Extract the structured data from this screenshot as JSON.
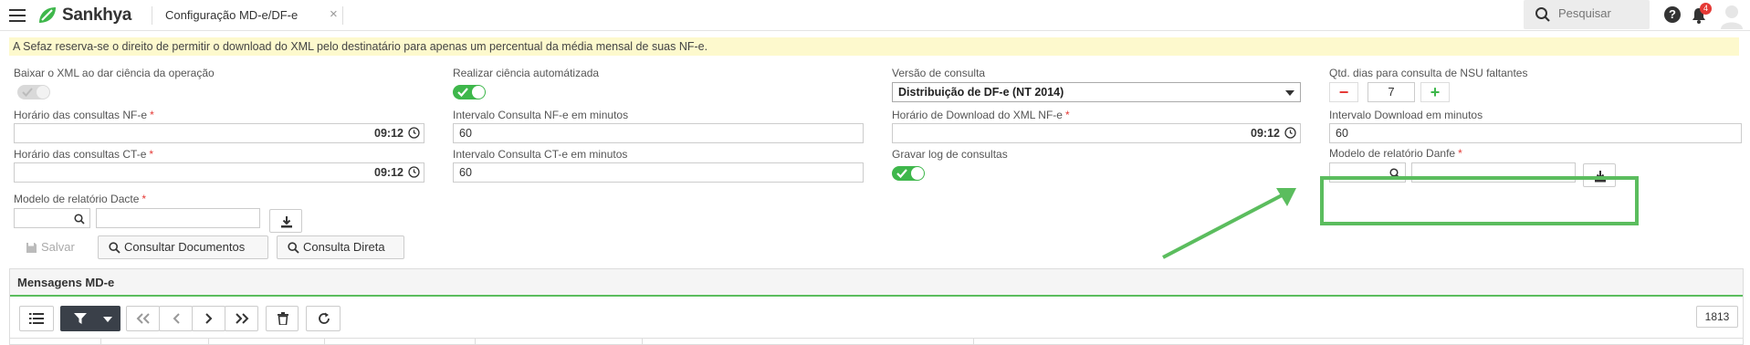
{
  "app": {
    "brand": "Sankhya",
    "tab_title": "Configuração MD-e/DF-e",
    "tab_close": "×"
  },
  "header": {
    "search_placeholder": "Pesquisar",
    "help": "?",
    "notification_count": "4"
  },
  "notice": "A Sefaz reserva-se o direito de permitir o download do XML pelo destinatário para apenas um percentual da média mensal de suas NF-e.",
  "form": {
    "baixar_xml": {
      "label": "Baixar o XML ao dar ciência da operação",
      "enabled": false
    },
    "realizar_ciencia": {
      "label": "Realizar ciência automátizada",
      "enabled": true
    },
    "versao_consulta": {
      "label": "Versão de consulta",
      "value": "Distribuição de DF-e (NT 2014)"
    },
    "qtd_dias": {
      "label": "Qtd. dias para consulta de NSU faltantes",
      "value": "7",
      "minus": "−",
      "plus": "+"
    },
    "horario_nfe": {
      "label": "Horário das consultas NF-e",
      "value": "09:12",
      "required": "*"
    },
    "intervalo_nfe": {
      "label": "Intervalo Consulta NF-e em minutos",
      "value": "60"
    },
    "horario_download": {
      "label": "Horário de Download do XML NF-e",
      "value": "09:12",
      "required": "*"
    },
    "intervalo_download": {
      "label": "Intervalo Download em minutos",
      "value": "60"
    },
    "horario_cte": {
      "label": "Horário das consultas CT-e",
      "value": "09:12",
      "required": "*"
    },
    "intervalo_cte": {
      "label": "Intervalo Consulta CT-e em minutos",
      "value": "60"
    },
    "gravar_log": {
      "label": "Gravar log de consultas",
      "enabled": true
    },
    "modelo_danfe": {
      "label": "Modelo de relatório Danfe",
      "required": "*",
      "code": "",
      "description": ""
    },
    "modelo_dacte": {
      "label": "Modelo de relatório Dacte",
      "required": "*",
      "code": "",
      "description": ""
    }
  },
  "actions": {
    "salvar": "Salvar",
    "consultar_documentos": "Consultar Documentos",
    "consulta_direta": "Consulta Direta"
  },
  "panel": {
    "title": "Mensagens MD-e",
    "record_count": "1813"
  },
  "colors": {
    "accent_green": "#3eb74b",
    "highlight_green": "#5bbd5e",
    "required_red": "#e53935",
    "notice_bg": "#fdf9cd"
  }
}
